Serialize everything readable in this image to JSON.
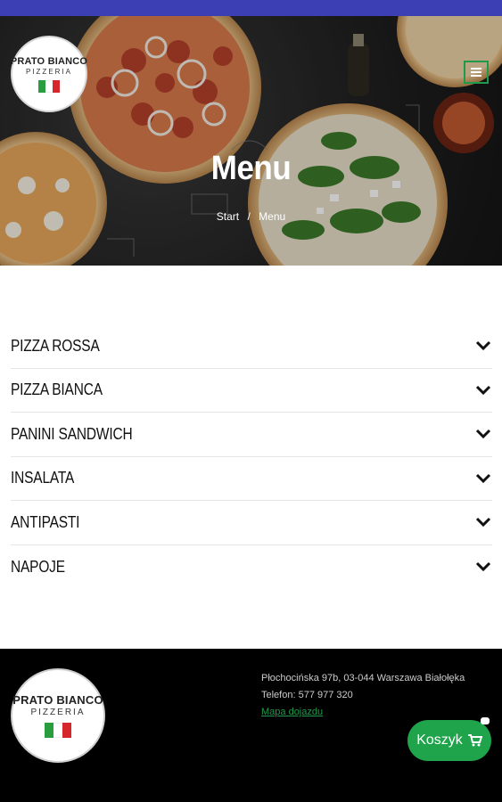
{
  "brand": {
    "name": "PRATO BIANCO",
    "subtitle": "PIZZERIA",
    "flag_colors": [
      "#2a9d3f",
      "#ffffff",
      "#d7262b"
    ],
    "accent": "#1fa34b",
    "status_bar_color": "#3b3fb3"
  },
  "header": {
    "menu_icon": "hamburger-icon"
  },
  "hero": {
    "title": "Menu",
    "breadcrumb": {
      "start": "Start",
      "separator": "/",
      "current": "Menu"
    }
  },
  "menu_categories": [
    {
      "label": "PIZZA ROSSA"
    },
    {
      "label": "PIZZA BIANCA"
    },
    {
      "label": "PANINI SANDWICH"
    },
    {
      "label": "INSALATA"
    },
    {
      "label": "ANTIPASTI"
    },
    {
      "label": "NAPOJE"
    }
  ],
  "footer": {
    "address": "Płochocińska 97b, 03-044 Warszawa Białołęka",
    "phone": "Telefon: 577 977 320",
    "map_link": "Mapa dojazdu"
  },
  "cart": {
    "label": "Koszyk",
    "icon": "cart-icon"
  }
}
